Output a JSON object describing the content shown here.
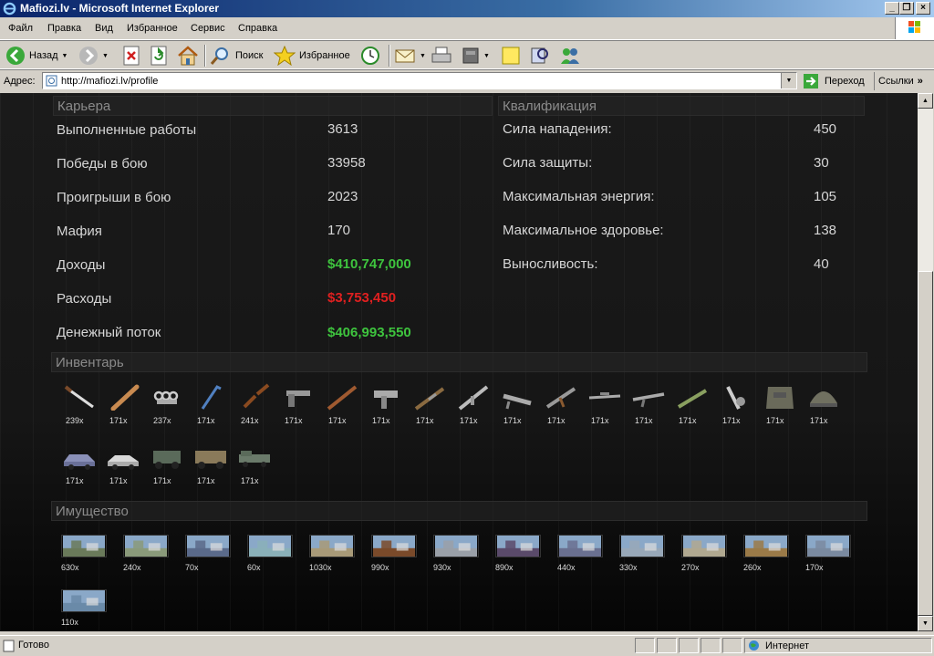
{
  "window": {
    "title": "Mafiozi.lv - Microsoft Internet Explorer"
  },
  "menu": [
    "Файл",
    "Правка",
    "Вид",
    "Избранное",
    "Сервис",
    "Справка"
  ],
  "toolbar": {
    "back": "Назад",
    "search": "Поиск",
    "favorites": "Избранное"
  },
  "address": {
    "label": "Адрес:",
    "url": "http://mafiozi.lv/profile",
    "go": "Переход",
    "links": "Ссылки"
  },
  "career": {
    "title": "Карьера",
    "rows": [
      {
        "label": "Выполненные работы",
        "value": "3613"
      },
      {
        "label": "Победы в бою",
        "value": "33958"
      },
      {
        "label": "Проигрыши в бою",
        "value": "2023"
      },
      {
        "label": "Мафия",
        "value": "170"
      },
      {
        "label": "Доходы",
        "value": "$410,747,000"
      },
      {
        "label": "Расходы",
        "value": "$3,753,450"
      },
      {
        "label": "Денежный поток",
        "value": "$406,993,550"
      }
    ]
  },
  "qualification": {
    "title": "Квалификация",
    "rows": [
      {
        "label": "Сила нападения:",
        "value": "450"
      },
      {
        "label": "Сила защиты:",
        "value": "30"
      },
      {
        "label": "Максимальная энергия:",
        "value": "105"
      },
      {
        "label": "Максимальное здоровье:",
        "value": "138"
      },
      {
        "label": "Выносливость:",
        "value": "40"
      }
    ]
  },
  "inventory": {
    "title": "Инвентарь",
    "items": [
      {
        "icon": "knife-icon",
        "count": "239x"
      },
      {
        "icon": "bat-icon",
        "count": "171x"
      },
      {
        "icon": "brass-knuckles-icon",
        "count": "237x"
      },
      {
        "icon": "crowbar-icon",
        "count": "171x"
      },
      {
        "icon": "nunchaku-icon",
        "count": "241x"
      },
      {
        "icon": "pistol-icon",
        "count": "171x"
      },
      {
        "icon": "shotgun-icon",
        "count": "171x"
      },
      {
        "icon": "uzi-icon",
        "count": "171x"
      },
      {
        "icon": "rifle-icon",
        "count": "171x"
      },
      {
        "icon": "assault-rifle-icon",
        "count": "171x"
      },
      {
        "icon": "machine-gun-icon",
        "count": "171x"
      },
      {
        "icon": "ak47-icon",
        "count": "171x"
      },
      {
        "icon": "sniper-rifle-icon",
        "count": "171x"
      },
      {
        "icon": "carbine-icon",
        "count": "171x"
      },
      {
        "icon": "grenade-launcher-icon",
        "count": "171x"
      },
      {
        "icon": "flamethrower-icon",
        "count": "171x"
      },
      {
        "icon": "body-armor-icon",
        "count": "171x"
      },
      {
        "icon": "helmet-icon",
        "count": "171x"
      },
      {
        "icon": "sedan-car-icon",
        "count": "171x"
      },
      {
        "icon": "sports-car-icon",
        "count": "171x"
      },
      {
        "icon": "suv-icon",
        "count": "171x"
      },
      {
        "icon": "hummer-icon",
        "count": "171x"
      },
      {
        "icon": "armored-truck-icon",
        "count": "171x"
      }
    ]
  },
  "property": {
    "title": "Имущество",
    "items": [
      {
        "icon": "village-house-icon",
        "count": "630x",
        "color": "#6a7a5a"
      },
      {
        "icon": "apartment-block-icon",
        "count": "240x",
        "color": "#8a9a7a"
      },
      {
        "icon": "office-building-icon",
        "count": "70x",
        "color": "#5a6a8a"
      },
      {
        "icon": "beach-resort-icon",
        "count": "60x",
        "color": "#8ab0b8"
      },
      {
        "icon": "mansion-icon",
        "count": "1030x",
        "color": "#a89a78"
      },
      {
        "icon": "casino-icon",
        "count": "990x",
        "color": "#7a4a2a"
      },
      {
        "icon": "hotel-icon",
        "count": "930x",
        "color": "#9aa0a8"
      },
      {
        "icon": "nightclub-icon",
        "count": "890x",
        "color": "#5a4a6a"
      },
      {
        "icon": "shopping-mall-icon",
        "count": "440x",
        "color": "#6a7090"
      },
      {
        "icon": "skyscraper-icon",
        "count": "330x",
        "color": "#98a8b8"
      },
      {
        "icon": "luxury-hotel-icon",
        "count": "270x",
        "color": "#b0a890"
      },
      {
        "icon": "palace-icon",
        "count": "260x",
        "color": "#9a7a48"
      },
      {
        "icon": "harbor-icon",
        "count": "170x",
        "color": "#7a8aa0"
      },
      {
        "icon": "coastal-city-icon",
        "count": "110x",
        "color": "#6a8aa8"
      }
    ]
  },
  "status": {
    "text": "Готово",
    "zone": "Интернет"
  },
  "colors": {
    "income": "#3ec43e",
    "expense": "#e02020",
    "text": "#d6d6d6"
  }
}
